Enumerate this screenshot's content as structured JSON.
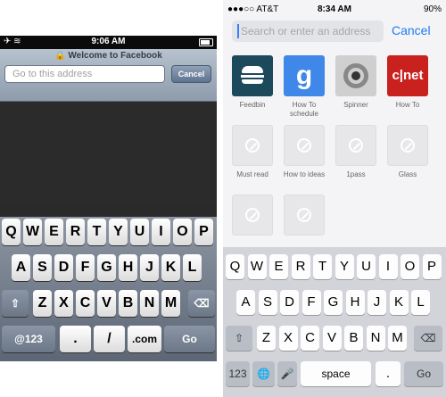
{
  "left": {
    "status": {
      "time": "9:06 AM"
    },
    "title": "Welcome to Facebook",
    "url_placeholder": "Go to this address",
    "cancel_label": "Cancel",
    "keys": {
      "row1": [
        "Q",
        "W",
        "E",
        "R",
        "T",
        "Y",
        "U",
        "I",
        "O",
        "P"
      ],
      "row2": [
        "A",
        "S",
        "D",
        "F",
        "G",
        "H",
        "J",
        "K",
        "L"
      ],
      "row3": [
        "Z",
        "X",
        "C",
        "V",
        "B",
        "N",
        "M"
      ],
      "numbers": "@123",
      "dot": ".",
      "slash": "/",
      "dotcom": ".com",
      "go": "Go"
    }
  },
  "right": {
    "status": {
      "carrier": "●●●○○ AT&T",
      "time": "8:34 AM",
      "battery": "90%"
    },
    "search_placeholder": "Search or enter an address",
    "cancel_label": "Cancel",
    "favorites": [
      {
        "label": "Feedbin",
        "icon": "burger-icon",
        "color": "#1c4a5c"
      },
      {
        "label": "How To schedule",
        "icon": "google-icon",
        "color": "#3f87e8"
      },
      {
        "label": "Spinner",
        "icon": "eye-icon",
        "color": "#cfcfcf"
      },
      {
        "label": "How To",
        "icon": "cnet-icon",
        "color": "#c9211e"
      },
      {
        "label": "Must read",
        "icon": "compass-icon"
      },
      {
        "label": "How to ideas",
        "icon": "compass-icon"
      },
      {
        "label": "1pass",
        "icon": "compass-icon"
      },
      {
        "label": "Glass",
        "icon": "compass-icon"
      },
      {
        "label": "",
        "icon": "compass-icon"
      },
      {
        "label": "",
        "icon": "compass-icon"
      }
    ],
    "keys": {
      "row1": [
        "Q",
        "W",
        "E",
        "R",
        "T",
        "Y",
        "U",
        "I",
        "O",
        "P"
      ],
      "row2": [
        "A",
        "S",
        "D",
        "F",
        "G",
        "H",
        "J",
        "K",
        "L"
      ],
      "row3": [
        "Z",
        "X",
        "C",
        "V",
        "B",
        "N",
        "M"
      ],
      "numbers": "123",
      "space": "space",
      "dot": ".",
      "go": "Go"
    }
  }
}
